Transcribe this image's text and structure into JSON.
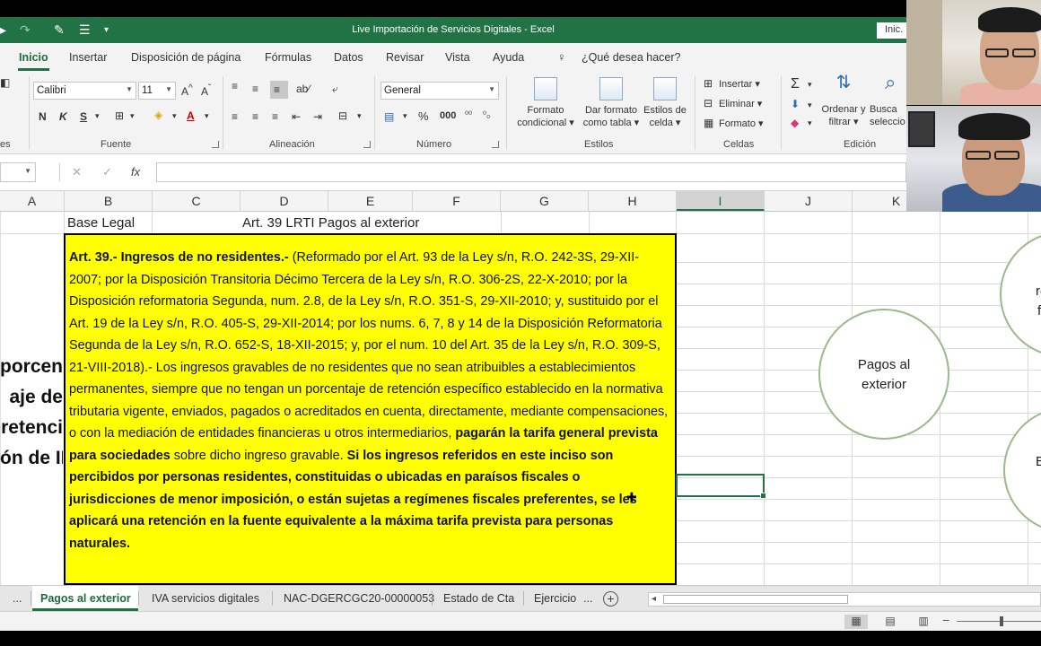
{
  "window": {
    "title": "Live Importación de Servicios Digitales  -  Excel",
    "signin_label": "Inic."
  },
  "ribbon_tabs": [
    {
      "label": "Inicio",
      "active": true
    },
    {
      "label": "Insertar"
    },
    {
      "label": "Disposición de página"
    },
    {
      "label": "Fórmulas"
    },
    {
      "label": "Datos"
    },
    {
      "label": "Revisar"
    },
    {
      "label": "Vista"
    },
    {
      "label": "Ayuda"
    }
  ],
  "tell_me": "¿Qué desea hacer?",
  "ribbon": {
    "font_name": "Calibri",
    "font_size": "11",
    "number_format": "General",
    "group_fuente": "Fuente",
    "group_alineacion": "Alineación",
    "group_numero": "Número",
    "group_estilos": "Estilos",
    "group_celdas": "Celdas",
    "group_edicion": "Edición",
    "group_left_partial": "es",
    "bold": "N",
    "italic": "K",
    "underline": "S",
    "formato_condicional_l1": "Formato",
    "formato_condicional_l2": "condicional ▾",
    "dar_formato_l1": "Dar formato",
    "dar_formato_l2": "como tabla ▾",
    "estilos_celda_l1": "Estilos de",
    "estilos_celda_l2": "celda ▾",
    "insertar": "Insertar ▾",
    "eliminar": "Eliminar ▾",
    "formato": "Formato ▾",
    "ordenar_l1": "Ordenar y",
    "ordenar_l2": "filtrar ▾",
    "buscar_l1": "Busca",
    "buscar_l2": "seleccio"
  },
  "columns": [
    "A",
    "B",
    "C",
    "D",
    "E",
    "F",
    "G",
    "H",
    "I",
    "J",
    "K"
  ],
  "selected_column": "I",
  "cells": {
    "b_label": "Base Legal",
    "d_label": "Art. 39 LRTI Pagos al exterior"
  },
  "side_label": [
    "porcent",
    "aje de",
    "retenci",
    "ón de IR"
  ],
  "law_text": {
    "heading": "Art. 39.- Ingresos de no residentes.-",
    "part1": " (Reformado por el Art. 93 de la Ley s/n, R.O. 242-3S, 29-XII-2007; por la Disposición Transitoria Décimo Tercera de la Ley s/n, R.O. 306-2S, 22-X-2010; por la Disposición reformatoria Segunda, num. 2.8, de la Ley s/n, R.O. 351-S, 29-XII-2010; y, sustituido por el Art. 19 de la Ley s/n, R.O. 405-S, 29-XII-2014; por los nums. 6, 7, 8 y 14 de la Disposición Reformatoria Segunda de la Ley s/n, R.O. 652-S, 18-XII-2015; y, por el num. 10 del Art. 35 de la Ley s/n, R.O. 309-S, 21-VIII-2018).- Los ingresos gravables de no residentes que no sean atribuibles a establecimientos permanentes, siempre que no tengan un porcentaje de retención específico establecido en la normativa tributaria vigente, enviados, pagados o acreditados en cuenta, directamente, mediante compensaciones, o con la mediación de entidades financieras u otros intermediarios, ",
    "bold1": "pagarán la tarifa general prevista para sociedades",
    "part2": " sobre dicho ingreso gravable. ",
    "bold2": "Si los ingresos referidos en este inciso son percibidos por personas residentes, constituidas o ubicadas en paraísos fiscales o jurisdicciones de menor imposición, o están sujetas a regímenes fiscales preferentes, se les aplicará una retención en la fuente equivalente a la máxima tarifa prevista para personas naturales."
  },
  "circles": {
    "main_l1": "Pagos al",
    "main_l2": "exterior",
    "partial_top_l1": "re",
    "partial_top_l2": "f",
    "partial_bottom": "B"
  },
  "sheet_tabs": [
    {
      "label": "...",
      "active": false
    },
    {
      "label": "Pagos al exterior",
      "active": true
    },
    {
      "label": "IVA servicios digitales",
      "active": false
    },
    {
      "label": "NAC-DGERCGC20-00000053",
      "active": false
    },
    {
      "label": "Estado de Cta",
      "active": false
    },
    {
      "label": "Ejercicio",
      "active": false
    },
    {
      "label": "...",
      "active": false
    }
  ],
  "colors": {
    "excel_green": "#217346",
    "highlight_yellow": "#ffff00",
    "circle_border": "#9bb98a"
  }
}
